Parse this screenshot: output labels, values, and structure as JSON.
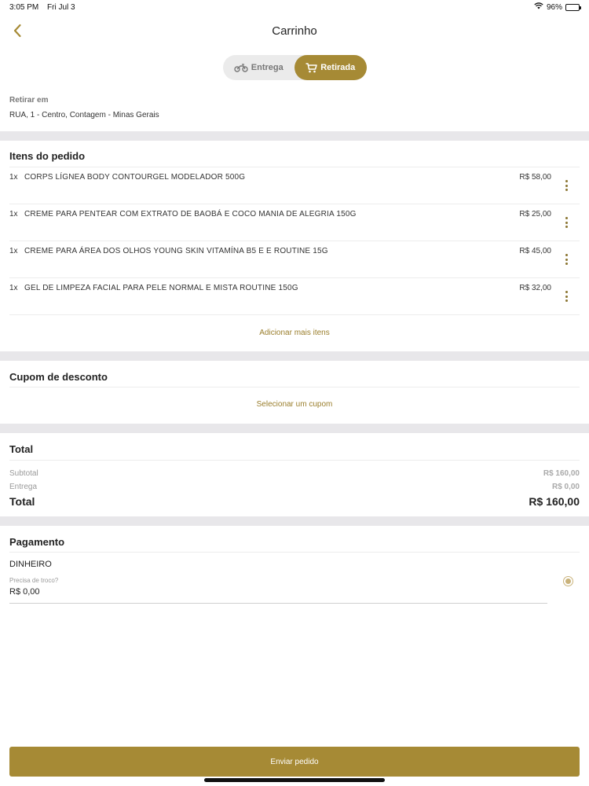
{
  "status": {
    "time": "3:05 PM",
    "date": "Fri Jul 3",
    "battery": "96%",
    "battery_level": 0.96
  },
  "header": {
    "title": "Carrinho"
  },
  "icons": {
    "back": "chevron-left-icon",
    "delivery": "motorcycle-icon",
    "pickup": "cart-icon",
    "menu": "kebab-menu-icon"
  },
  "colors": {
    "accent": "#a68a35"
  },
  "mode_toggle": {
    "delivery_label": "Entrega",
    "pickup_label": "Retirada",
    "selected": "Retirada"
  },
  "pickup": {
    "label": "Retirar em",
    "address": "RUA, 1 - Centro, Contagem  - Minas Gerais"
  },
  "items_section": {
    "title": "Itens do pedido",
    "items": [
      {
        "qty": "1x",
        "name": "CORPS LÍGNEA BODY CONTOURGEL MODELADOR 500G",
        "price": "R$ 58,00"
      },
      {
        "qty": "1x",
        "name": "CREME PARA PENTEAR COM EXTRATO DE BAOBÁ E COCO MANIA DE ALEGRIA 150G",
        "price": "R$ 25,00"
      },
      {
        "qty": "1x",
        "name": "CREME PARA ÁREA DOS OLHOS YOUNG SKIN VITAMÍNA B5 E E ROUTINE 15G",
        "price": "R$ 45,00"
      },
      {
        "qty": "1x",
        "name": "GEL DE LIMPEZA FACIAL PARA PELE NORMAL E MISTA ROUTINE 150G",
        "price": "R$ 32,00"
      }
    ],
    "add_more": "Adicionar mais itens"
  },
  "coupon": {
    "title": "Cupom de desconto",
    "select": "Selecionar um cupom"
  },
  "totals": {
    "title": "Total",
    "subtotal_label": "Subtotal",
    "subtotal_value": "R$ 160,00",
    "delivery_label": "Entrega",
    "delivery_value": "R$ 0,00",
    "total_label": "Total",
    "total_value": "R$ 160,00"
  },
  "payment": {
    "title": "Pagamento",
    "method": "DINHEIRO",
    "change_label": "Precisa de troco?",
    "change_value": "R$ 0,00"
  },
  "submit": {
    "label": "Enviar pedido"
  }
}
